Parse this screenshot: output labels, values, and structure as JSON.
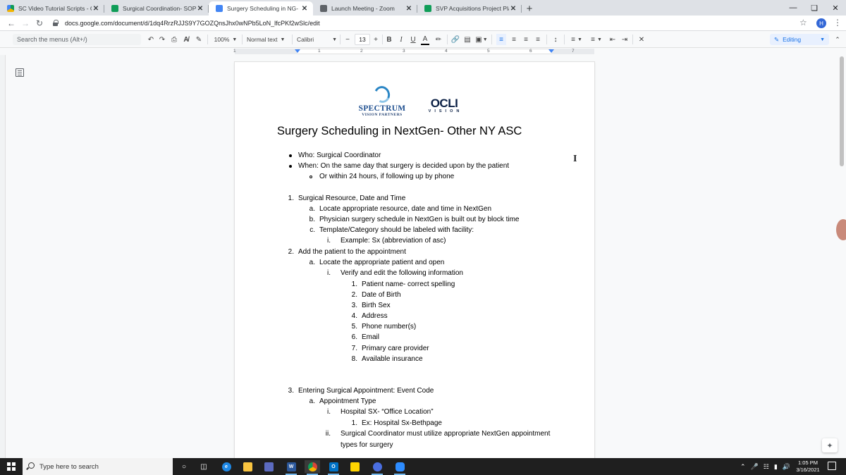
{
  "browser": {
    "tabs": [
      {
        "title": "SC Video Tutorial Scripts - Goog",
        "icon": "drive-icon",
        "active": false
      },
      {
        "title": "Surgical Coordination- SOP Man",
        "icon": "sheets-icon",
        "active": false
      },
      {
        "title": "Surgery Scheduling in NG- Othe",
        "icon": "docs-icon",
        "active": true
      },
      {
        "title": "Launch Meeting - Zoom",
        "icon": "zoom-icon",
        "active": false
      },
      {
        "title": "SVP Acquisitions Project Plan- U",
        "icon": "sheets-icon",
        "active": false
      }
    ],
    "close_glyph": "✕",
    "new_tab_glyph": "+",
    "url": "docs.google.com/document/d/1dq4RrzRJJS9Y7GOZQnsJhx0wNPb5LoN_lfcPKf2wSlc/edit",
    "profile_initial": "H"
  },
  "toolbar": {
    "menu_search_placeholder": "Search the menus (Alt+/)",
    "zoom": "100%",
    "style": "Normal text",
    "font": "Calibri",
    "font_size": "13",
    "minus": "−",
    "plus": "+",
    "bold": "B",
    "italic": "I",
    "underline": "U",
    "text_color": "A",
    "mode": "Editing"
  },
  "ruler": {
    "numbers": [
      "1",
      "1",
      "2",
      "3",
      "4",
      "5",
      "6",
      "7"
    ]
  },
  "document": {
    "logo_spectrum_name": "SPECTRUM",
    "logo_spectrum_sub": "VISION PARTNERS",
    "logo_ocli_name": "OCLI",
    "logo_ocli_sub": "VISION",
    "title": "Surgery Scheduling in NextGen- Other NY ASC",
    "bullets": [
      "Who:  Surgical Coordinator",
      "When: On the same day that surgery is decided upon by the patient"
    ],
    "sub_bullet": "Or within 24 hours, if following up by phone",
    "sections": {
      "s1_marker": "1.",
      "s1": "Surgical Resource, Date and Time",
      "s1a_marker": "a.",
      "s1a": "Locate appropriate resource, date and time in NextGen",
      "s1b_marker": "b.",
      "s1b": "Physician surgery schedule in NextGen is built out by block time",
      "s1c_marker": "c.",
      "s1c": "Template/Category should be labeled with facility:",
      "s1ci_marker": "i.",
      "s1ci": "Example: Sx (abbreviation of asc)",
      "s2_marker": "2.",
      "s2": "Add the patient to the appointment",
      "s2a_marker": "a.",
      "s2a": "Locate the appropriate patient and open",
      "s2ai_marker": "i.",
      "s2ai": "Verify and edit the following information",
      "s3_marker": "3.",
      "s3": "Entering Surgical Appointment: Event Code",
      "s3a_marker": "a.",
      "s3a": "Appointment Type",
      "s3ai_marker": "i.",
      "s3ai": "Hospital SX- “Office Location”",
      "s3ai1_marker": "1.",
      "s3ai1": "Ex: Hospital Sx-Bethpage",
      "s3aii_marker": "ii.",
      "s3aii_line1": "Surgical Coordinator must utilize appropriate NextGen appointment",
      "s3aii_line2": "types for surgery"
    },
    "verify_list": [
      "Patient name- correct spelling",
      "Date of Birth",
      "Birth Sex",
      "Address",
      "Phone number(s)",
      "Email",
      "Primary care provider",
      "Available insurance"
    ]
  },
  "taskbar": {
    "search_placeholder": "Type here to search",
    "time": "1:05 PM",
    "date": "3/16/2021"
  }
}
